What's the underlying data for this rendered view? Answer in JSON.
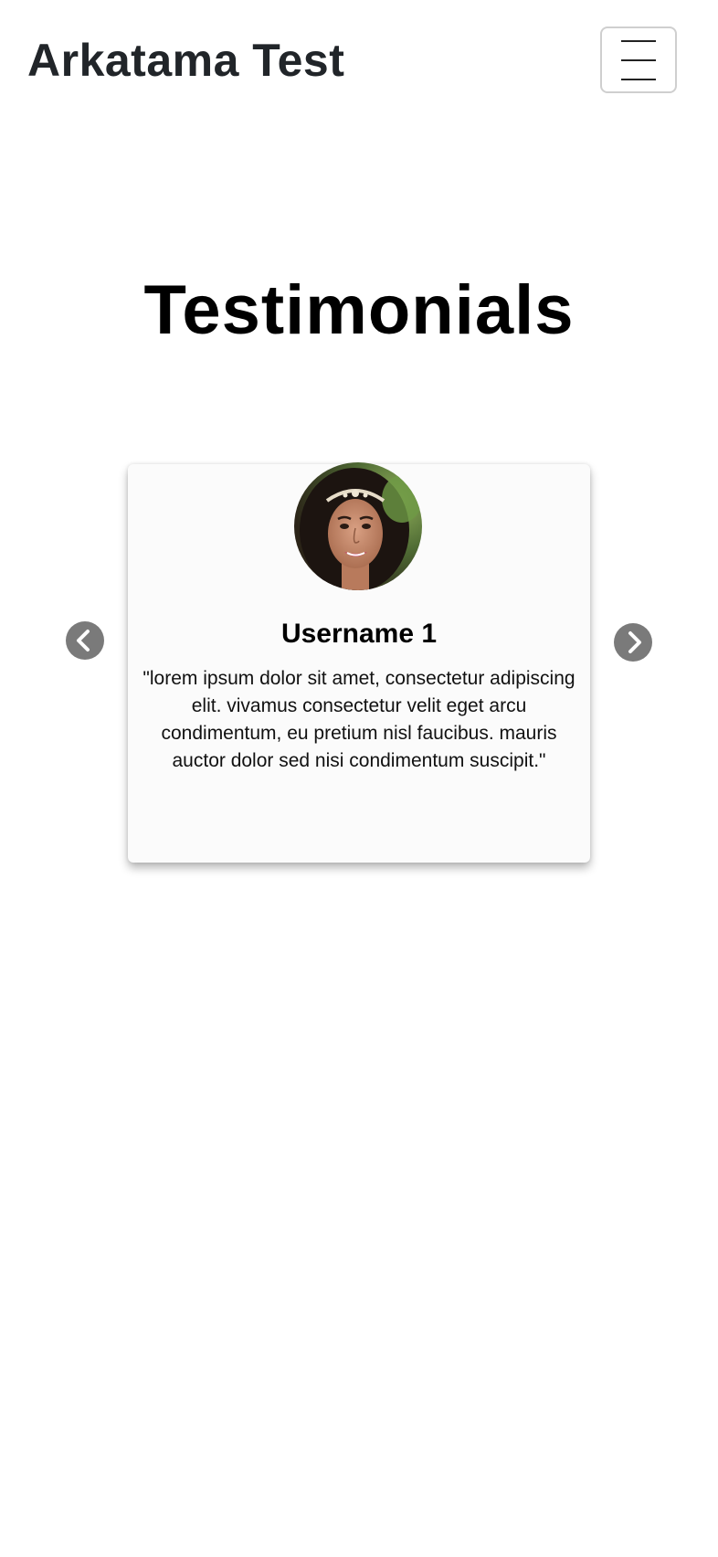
{
  "navbar": {
    "brand": "Arkatama Test",
    "toggler_icon": "hamburger-menu-icon"
  },
  "testimonials": {
    "heading": "Testimonials",
    "prev_icon": "chevron-left-icon",
    "next_icon": "chevron-right-icon",
    "items": [
      {
        "username": "Username 1",
        "quote": "\"lorem ipsum dolor sit amet, consectetur adipiscing elit. vivamus consectetur velit eget arcu condimentum, eu pretium nisl faucibus. mauris auctor dolor sed nisi condimentum suscipit.\"",
        "avatar": "user-portrait-photo"
      }
    ]
  },
  "colors": {
    "text": "#212529",
    "card_bg": "#fbfbfb",
    "arrow_bg": "#7a7a7a"
  }
}
